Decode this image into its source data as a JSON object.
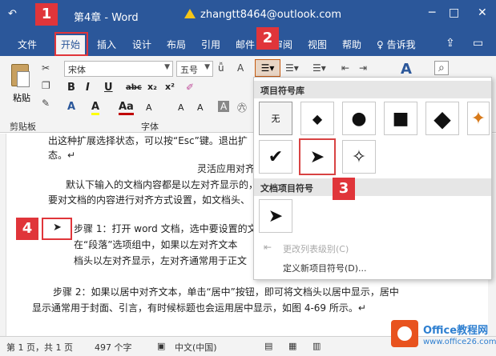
{
  "titlebar": {
    "qa_glyph": "↶",
    "doc_title": "第4章 - Word",
    "account": "zhangtt8464@outlook.com",
    "minimize": "─",
    "restore": "□",
    "close": "✕"
  },
  "menu": {
    "tabs": [
      "文件",
      "开始",
      "插入",
      "设计",
      "布局",
      "引用",
      "邮件",
      "审阅",
      "视图",
      "帮助",
      "告诉我"
    ],
    "active_tab": "开始",
    "tell_me_icon": "lightbulb-icon"
  },
  "ribbon": {
    "paste_label": "粘贴",
    "clipboard_group": "剪贴板",
    "font_group": "字体",
    "font_name": "宋体",
    "font_size": "五号",
    "format_buttons": [
      "B",
      "I",
      "U",
      "abc",
      "x₂",
      "x²"
    ],
    "second_row": [
      "A",
      "A",
      "Aa",
      "A",
      "A",
      "A"
    ],
    "font_color_hex": "#c00000",
    "highlight_hex": "#ffff00",
    "style_glyph": "A"
  },
  "dropdown": {
    "library_header": "项目符号库",
    "none_label": "无",
    "bullets_row1": [
      "无",
      "◆",
      "●",
      "■",
      "◆",
      "✦"
    ],
    "bullets_row2": [
      "✔",
      "➤",
      "✧"
    ],
    "doc_header": "文档项目符号",
    "doc_bullets": [
      "➤"
    ],
    "change_level": "更改列表级别(C)",
    "define_new": "定义新项目符号(D)..."
  },
  "document": {
    "line1": "出这种扩展选择状态，可以按“Esc”键。退出扩",
    "line2": "态。↵",
    "heading": "灵活应用对齐",
    "para1": "默认下输入的文档内容都是以左对齐显示的，",
    "para1b": "要对文档的内容进行对齐方式设置，如文档头、",
    "step1a": "步骤 1：打开 word 文档，选中要设置的文",
    "step1b": "在“段落”选项组中，如果以左对齐文本",
    "step1c": "档头以左对齐显示，左对齐通常用于正文",
    "bullet_glyph": "➤",
    "step2a": "步骤 2：如果以居中对齐文本，单击“居中”按钮",
    "step2a_end": "，即可将文档头以居中显示，居中",
    "step2b": "显示通常用于封面、引言，有时候标题也会运用居中显示，如图 4-69 所示。↵"
  },
  "badges": [
    "1",
    "2",
    "3",
    "4"
  ],
  "status": {
    "page": "第 1 页，共 1 页",
    "words": "497 个字",
    "lang": "中文(中国)"
  },
  "watermark": {
    "line1": "Office教程网",
    "line2": "www.office26.com"
  }
}
